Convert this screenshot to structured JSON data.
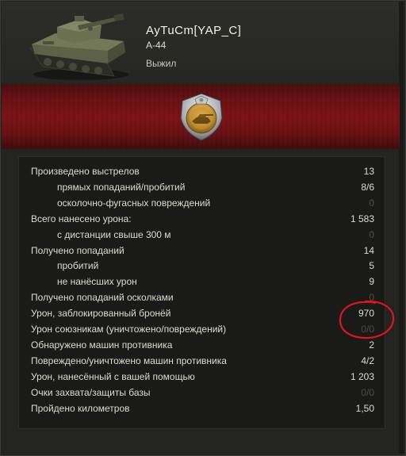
{
  "header": {
    "player_name": "AyTuCm[YAP_C]",
    "tank_name": "A-44",
    "status": "Выжил"
  },
  "icons": {
    "tank": "tank-icon",
    "medal": "medal-icon"
  },
  "colors": {
    "banner": "#7c1416",
    "annotation": "#e0141c",
    "text": "#dedcd0",
    "dim_value": "#4e4d47"
  },
  "stats": [
    {
      "label": "Произведено выстрелов",
      "value": "13",
      "sub": false,
      "dim": false
    },
    {
      "label": "прямых попаданий/пробитий",
      "value": "8/6",
      "sub": true,
      "dim": false
    },
    {
      "label": "осколочно-фугасных повреждений",
      "value": "0",
      "sub": true,
      "dim": true
    },
    {
      "label": "Всего нанесено урона:",
      "value": "1 583",
      "sub": false,
      "dim": false
    },
    {
      "label": "с дистанции свыше 300 м",
      "value": "0",
      "sub": true,
      "dim": true
    },
    {
      "label": "Получено попаданий",
      "value": "14",
      "sub": false,
      "dim": false
    },
    {
      "label": "пробитий",
      "value": "5",
      "sub": true,
      "dim": false
    },
    {
      "label": "не нанёсших урон",
      "value": "9",
      "sub": true,
      "dim": false
    },
    {
      "label": "Получено попаданий осколками",
      "value": "0",
      "sub": false,
      "dim": true
    },
    {
      "label": "Урон, заблокированный бронёй",
      "value": "970",
      "sub": false,
      "dim": false
    },
    {
      "label": "Урон союзникам (уничтожено/повреждений)",
      "value": "0/0",
      "sub": false,
      "dim": true
    },
    {
      "label": "Обнаружено машин противника",
      "value": "2",
      "sub": false,
      "dim": false
    },
    {
      "label": "Повреждено/уничтожено машин противника",
      "value": "4/2",
      "sub": false,
      "dim": false
    },
    {
      "label": "Урон, нанесённый с вашей помощью",
      "value": "1 203",
      "sub": false,
      "dim": false
    },
    {
      "label": "Очки захвата/защиты базы",
      "value": "0/0",
      "sub": false,
      "dim": true
    },
    {
      "label": "Пройдено километров",
      "value": "1,50",
      "sub": false,
      "dim": false
    }
  ]
}
